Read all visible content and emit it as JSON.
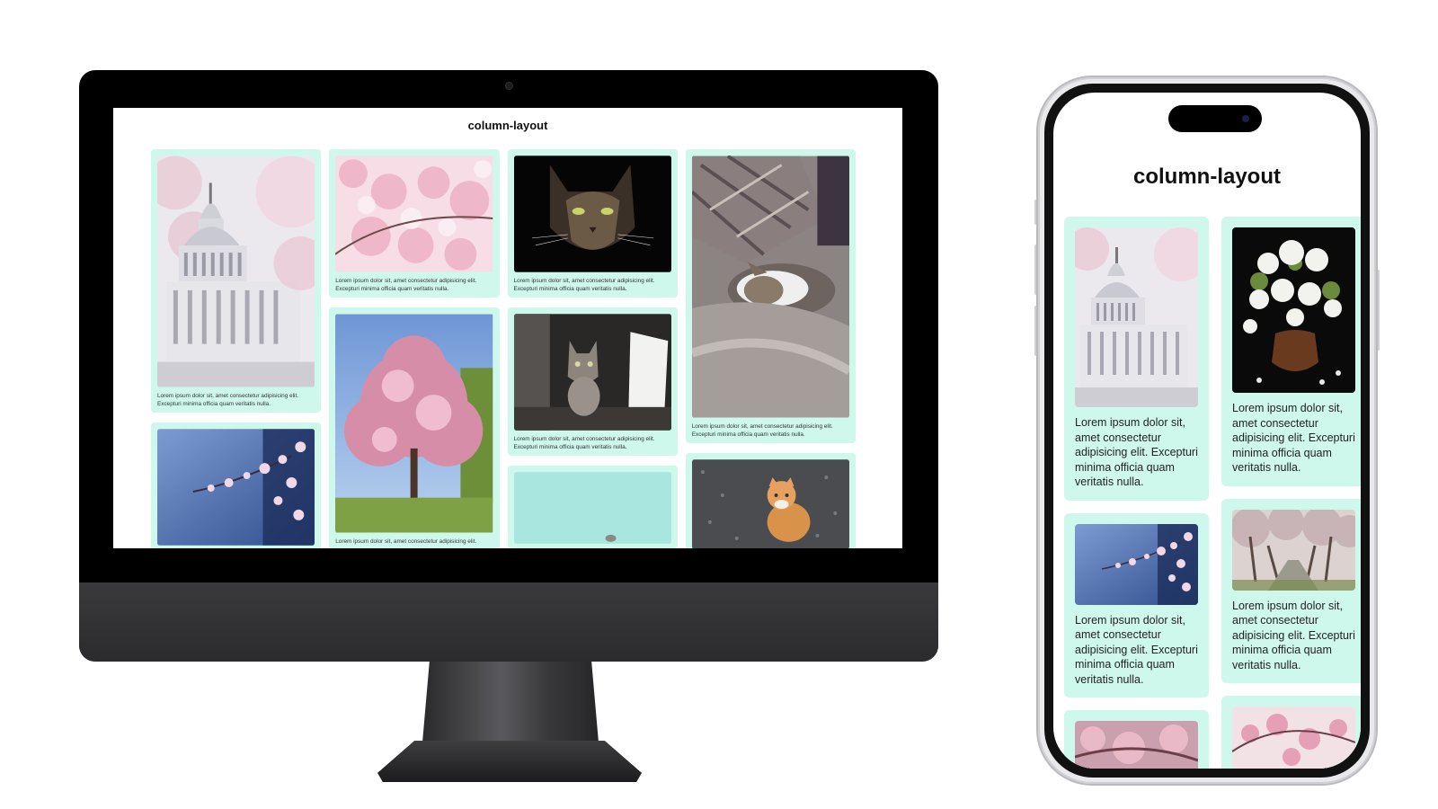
{
  "desktop": {
    "title": "column-layout",
    "caption_line1": "Lorem ipsum dolor sit, amet consectetur adipisicing elit.",
    "caption_line2": "Excepturi minima officia quam veritatis nulla.",
    "columns": [
      [
        {
          "image": "capitol-cherry-blossoms"
        },
        {
          "image": "blossom-branch-blue-sky"
        }
      ],
      [
        {
          "image": "pink-cherry-blossoms"
        },
        {
          "image": "blooming-cherry-tree"
        }
      ],
      [
        {
          "image": "cat-face-dark"
        },
        {
          "image": "kitten-in-box"
        },
        {
          "image": "cat-mint-background"
        }
      ],
      [
        {
          "image": "cat-sleeping-blanket"
        },
        {
          "image": "orange-cat-gravel"
        }
      ]
    ]
  },
  "mobile": {
    "title": "column-layout",
    "caption": "Lorem ipsum dolor sit, amet consectetur adipisicing elit. Excepturi minima officia quam veritatis nulla.",
    "columns": [
      [
        {
          "image": "capitol-cherry-blossoms"
        },
        {
          "image": "blossom-branch-blue-sky"
        },
        {
          "image": "cherry-blossom-closeup"
        }
      ],
      [
        {
          "image": "white-flowers-vase"
        },
        {
          "image": "cherry-tree-path"
        },
        {
          "image": "pink-blossom-branches"
        }
      ]
    ]
  },
  "colors": {
    "card_background": "#cff8ec",
    "page_background": "#ffffff",
    "device_bezel": "#000000"
  }
}
